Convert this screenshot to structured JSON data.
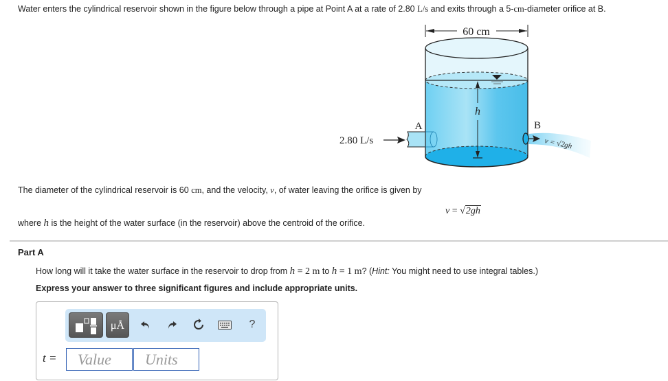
{
  "intro": {
    "text_before": "Water enters the cylindrical reservoir shown in the figure below through a pipe at Point A at a rate of 2.80 ",
    "rate_unit": "L/s",
    "text_middle": " and exits through a 5-",
    "diameter_unit": "cm",
    "text_after": "-diameter orifice at B."
  },
  "figure": {
    "width_label": "60 cm",
    "inflow_label": "2.80 L/s",
    "point_a": "A",
    "point_b": "B",
    "height_label": "h",
    "jet_label": "v = √2gh",
    "colors": {
      "water": "#5cc6ee",
      "water_light": "#a9e3f6",
      "tank_empty": "#e4f6fc",
      "water_bottom": "#1fb0e8",
      "outline": "#222222"
    }
  },
  "description": {
    "text_before": "The diameter of the cylindrical reservoir is 60 ",
    "unit": "cm",
    "text_middle": ", and the velocity, ",
    "var": "v",
    "text_after": ", of water leaving the orifice is given by"
  },
  "formula": {
    "lhs": "v",
    "eq": " = ",
    "radicand": "2gh"
  },
  "where": {
    "text_before": "where ",
    "var": "h",
    "text_after": " is the height of the water surface (in the reservoir) above the centroid of the orifice."
  },
  "part": {
    "title": "Part A",
    "question_1": "How long will it take the water surface in the reservoir to drop from ",
    "h1": "h",
    "eq1": " = 2 m",
    "to": " to ",
    "h2": "h",
    "eq2": " = 1 m",
    "question_2": "? (",
    "hint_label": "Hint:",
    "hint_text": " You might need to use integral tables.)",
    "instruction": "Express your answer to three significant figures and include appropriate units."
  },
  "answer": {
    "variable_label": "t =",
    "value_placeholder": "Value",
    "units_placeholder": "Units",
    "toolbar": {
      "templates_icon": "templates-icon",
      "units_label": "μÅ",
      "undo_icon": "↶",
      "redo_icon": "↷",
      "reset_icon": "↻",
      "keyboard_icon": "keyboard-icon",
      "help_label": "?"
    }
  }
}
